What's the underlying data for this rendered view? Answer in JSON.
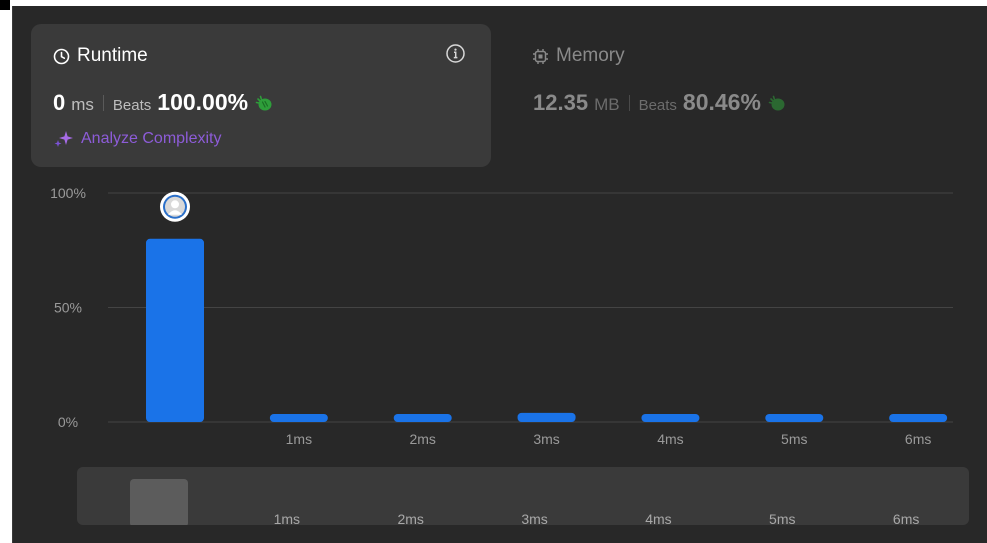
{
  "runtime": {
    "title": "Runtime",
    "value": "0",
    "unit": "ms",
    "beats_label": "Beats",
    "beats_value": "100.00%",
    "analyze_label": "Analyze Complexity"
  },
  "memory": {
    "title": "Memory",
    "value": "12.35",
    "unit": "MB",
    "beats_label": "Beats",
    "beats_value": "80.46%"
  },
  "colors": {
    "bar": "#1a73e8",
    "accent_purple": "#8d5cd8",
    "clap_green": "#2e9e3a",
    "background": "#282828",
    "card": "#3a3a3a"
  },
  "chart_data": {
    "type": "bar",
    "categories": [
      "",
      "1ms",
      "2ms",
      "3ms",
      "4ms",
      "5ms",
      "6ms"
    ],
    "values": [
      80,
      3.5,
      3.5,
      4,
      3.5,
      3.5,
      3.5
    ],
    "ylim": [
      0,
      100
    ],
    "yticks": [
      "0%",
      "50%",
      "100%"
    ],
    "grid": true,
    "highlight_index": 0,
    "marker_icon": "user-avatar-icon"
  },
  "minimap": {
    "labels": [
      "1ms",
      "2ms",
      "3ms",
      "4ms",
      "5ms",
      "6ms"
    ]
  }
}
